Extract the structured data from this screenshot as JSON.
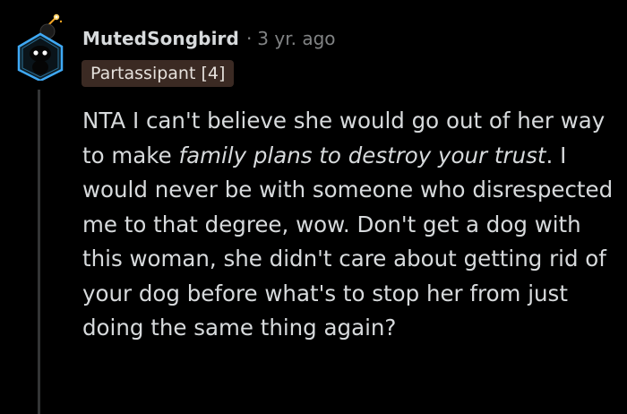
{
  "comment": {
    "author": "MutedSongbird",
    "separator": "·",
    "timestamp": "3 yr. ago",
    "flair": "Partassipant [4]",
    "body": {
      "part1": "NTA I can't believe she would go out of her way to make ",
      "emphasis1": "family plans to destroy your trust",
      "part2": ". I would never be with someone who disrespected me to that degree, wow. Don't get a dog with this woman, she didn't care about getting rid of your dog before what's to stop her from just doing the same thing again?"
    }
  },
  "colors": {
    "background": "#000000",
    "text": "#d7dadc",
    "muted": "#818384",
    "flair_bg": "#3b2a23",
    "thread_line": "#343536",
    "avatar_accent": "#3fa9f5",
    "avatar_spark": "#f5a623"
  },
  "icons": {
    "avatar": "snoo-avatar-icon"
  }
}
